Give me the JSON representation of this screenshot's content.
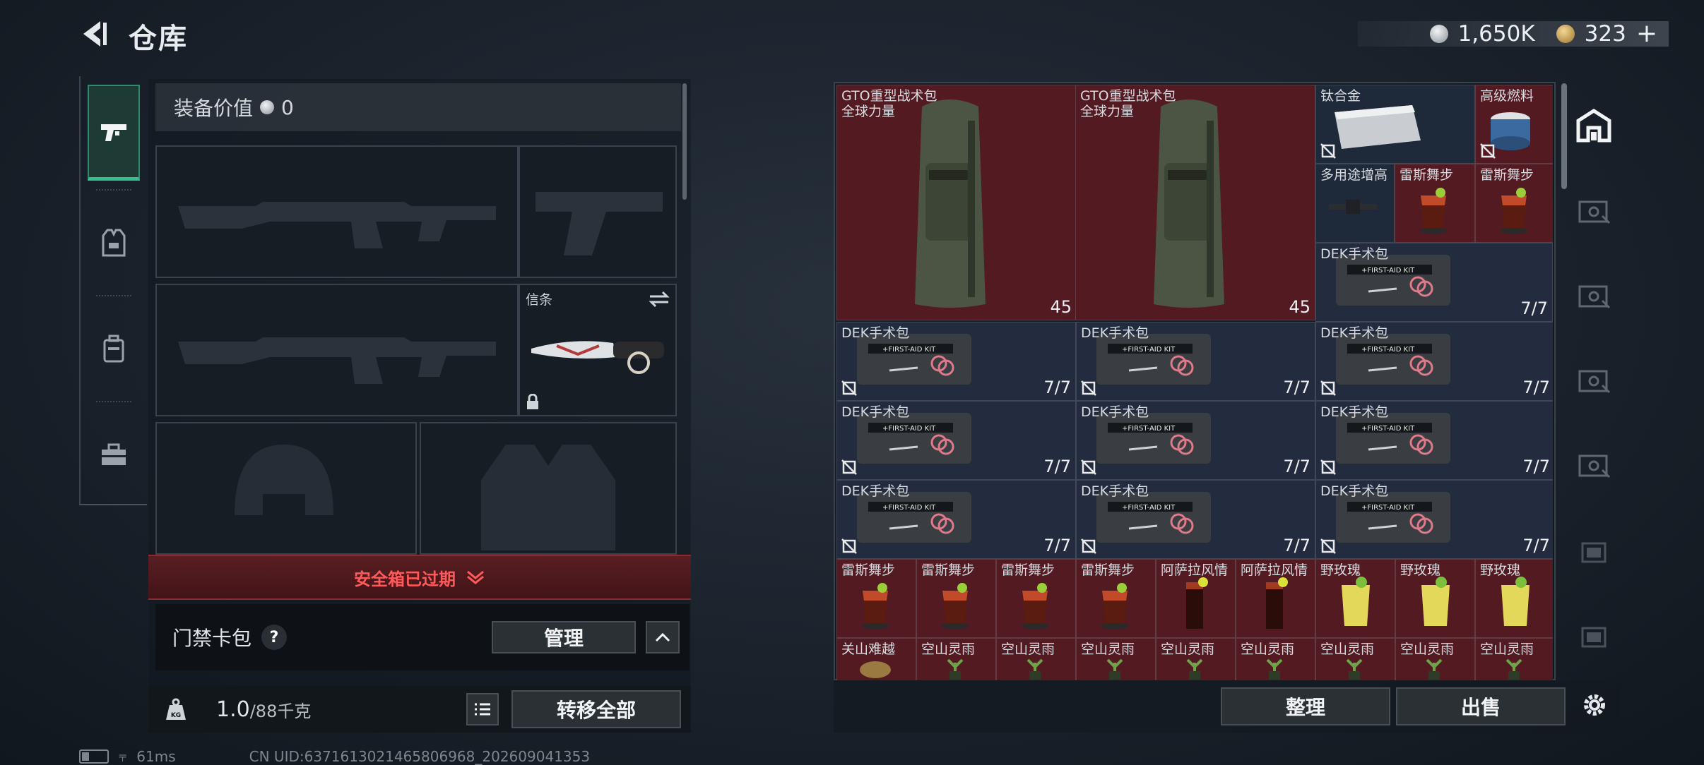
{
  "header": {
    "title": "仓库",
    "currency_silver": "1,650K",
    "currency_gold": "323"
  },
  "tabs": [
    {
      "icon": "pistol-icon",
      "active": true
    },
    {
      "icon": "vest-icon",
      "active": false
    },
    {
      "icon": "backpack-icon",
      "active": false
    },
    {
      "icon": "toolbox-icon",
      "active": false
    }
  ],
  "loadout": {
    "value_label": "装备价值",
    "value": "0",
    "melee_label": "信条",
    "safebox_expired": "安全箱已过期",
    "keycard_label": "门禁卡包",
    "keycard_help": "?",
    "manage_label": "管理",
    "weight_value": "1.0",
    "weight_max": "/88千克",
    "transfer_all": "转移全部"
  },
  "inventory": {
    "big_items": [
      {
        "name": "GTO重型战术包",
        "sub": "全球力量",
        "qty": "45"
      },
      {
        "name": "GTO重型战术包",
        "sub": "全球力量",
        "qty": "45"
      }
    ],
    "titanium": "钛合金",
    "fuel": "高级燃料",
    "multi": "多用途增高",
    "cocktail": "雷斯舞步",
    "medkit": "DEK手术包",
    "medkit_qty": "7/7",
    "cocktail2": "阿萨拉风情",
    "rose": "野玫瑰",
    "guanshan": "关山难越",
    "kongshan": "空山灵雨"
  },
  "actions": {
    "sort": "整理",
    "sell": "出售"
  },
  "status": {
    "ping": "61ms",
    "uid": "CN UID:6371613021465806968_202609041353"
  }
}
